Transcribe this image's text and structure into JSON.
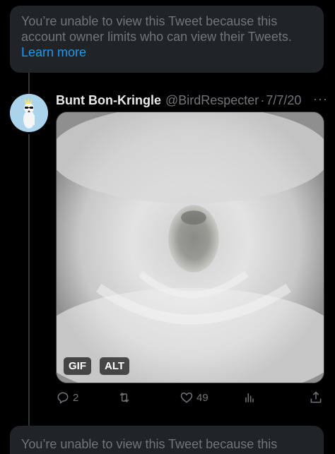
{
  "notice": {
    "message": "You’re unable to view this Tweet because this account owner limits who can view their Tweets.",
    "link": "Learn more"
  },
  "tweet": {
    "author_name": "Bunt Bon-Kringle",
    "handle": "@BirdRespecter",
    "separator": "·",
    "date": "7/7/20",
    "more": "···",
    "media_badges": {
      "gif": "GIF",
      "alt": "ALT"
    },
    "stats": {
      "replies": "2",
      "likes": "49"
    },
    "icons": {
      "reply": "reply-icon",
      "retweet": "retweet-icon",
      "like": "heart-icon",
      "views": "views-icon",
      "share": "share-icon"
    }
  },
  "next_notice": {
    "message": "You’re unable to view this Tweet because this"
  },
  "colors": {
    "background": "#000000",
    "card": "#202327",
    "muted": "#71767b",
    "accent": "#1d9bf0",
    "text": "#e7e9ea"
  }
}
